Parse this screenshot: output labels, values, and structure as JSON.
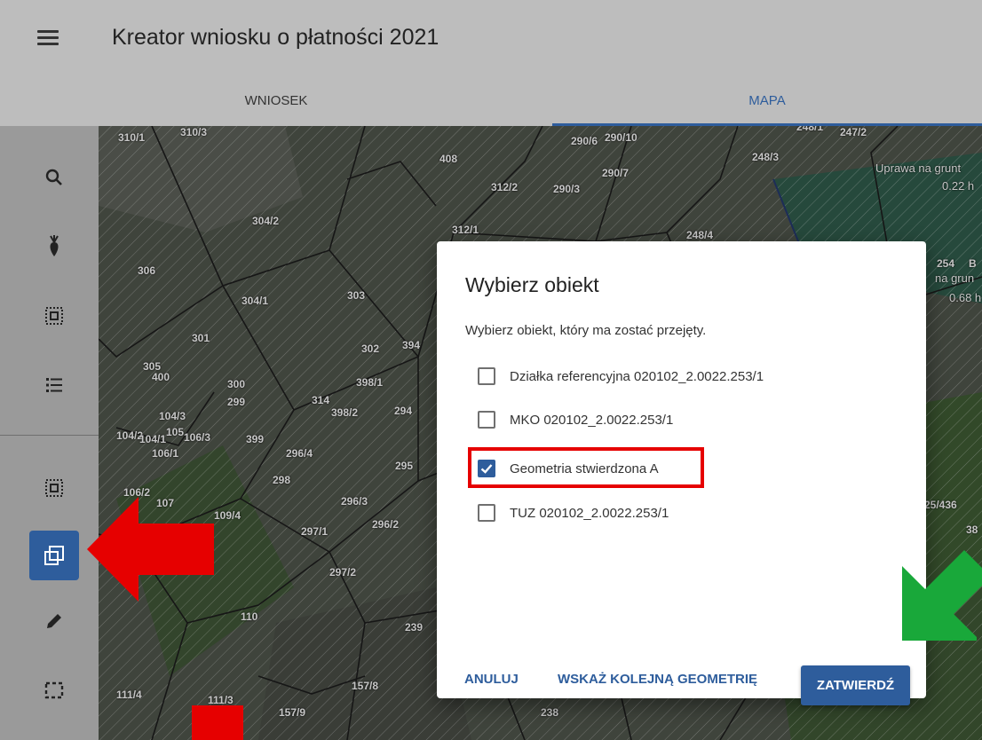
{
  "app": {
    "title": "Kreator wniosku o płatności 2021"
  },
  "tabs": [
    {
      "label": "WNIOSEK",
      "active": false
    },
    {
      "label": "MAPA",
      "active": true
    }
  ],
  "rail": {
    "top": [
      "search-icon",
      "plant-icon",
      "selection-icon",
      "list-icon"
    ],
    "bottom": [
      "selection-icon",
      "copy-geometry-icon",
      "pencil-icon",
      "dashed-rectangle-icon"
    ],
    "active_item": "copy-geometry-icon"
  },
  "map": {
    "parcels": [
      "310/1",
      "310/3",
      "408",
      "290/6",
      "290/10",
      "248/1",
      "247/2",
      "290/7",
      "248/3",
      "312/2",
      "290/3",
      "304/2",
      "312/1",
      "248/4",
      "306",
      "304/1",
      "303",
      "301",
      "302",
      "394",
      "305",
      "400",
      "300",
      "398/1",
      "314",
      "398/2",
      "104/3",
      "299",
      "294",
      "104/2",
      "104/1",
      "105",
      "106/3",
      "399",
      "106/1",
      "296/4",
      "295",
      "298",
      "106/2",
      "107",
      "109/4",
      "296/3",
      "296/2",
      "297/1",
      "297/2",
      "110",
      "239",
      "111/4",
      "111/3",
      "157/8",
      "157/9",
      "238",
      "25/436",
      "38",
      "254",
      "B"
    ],
    "notes": [
      "Uprawa na grunt",
      "0.22 h",
      "na grun",
      "0.68 h"
    ]
  },
  "dialog": {
    "title": "Wybierz obiekt",
    "subtitle": "Wybierz obiekt, który ma zostać przejęty.",
    "options": [
      {
        "label": "Działka referencyjna 020102_2.0022.253/1",
        "checked": false
      },
      {
        "label": "MKO 020102_2.0022.253/1",
        "checked": false
      },
      {
        "label": "Geometria stwierdzona A",
        "checked": true
      },
      {
        "label": "TUZ 020102_2.0022.253/1",
        "checked": false
      }
    ],
    "buttons": {
      "cancel": "ANULUJ",
      "next_geometry": "WSKAŻ KOLEJNĄ GEOMETRIĘ",
      "confirm": "ZATWIERDŹ"
    }
  },
  "colors": {
    "accent": "#2e5d9c",
    "annotation_red": "#e60000",
    "annotation_green": "#19a83a"
  }
}
